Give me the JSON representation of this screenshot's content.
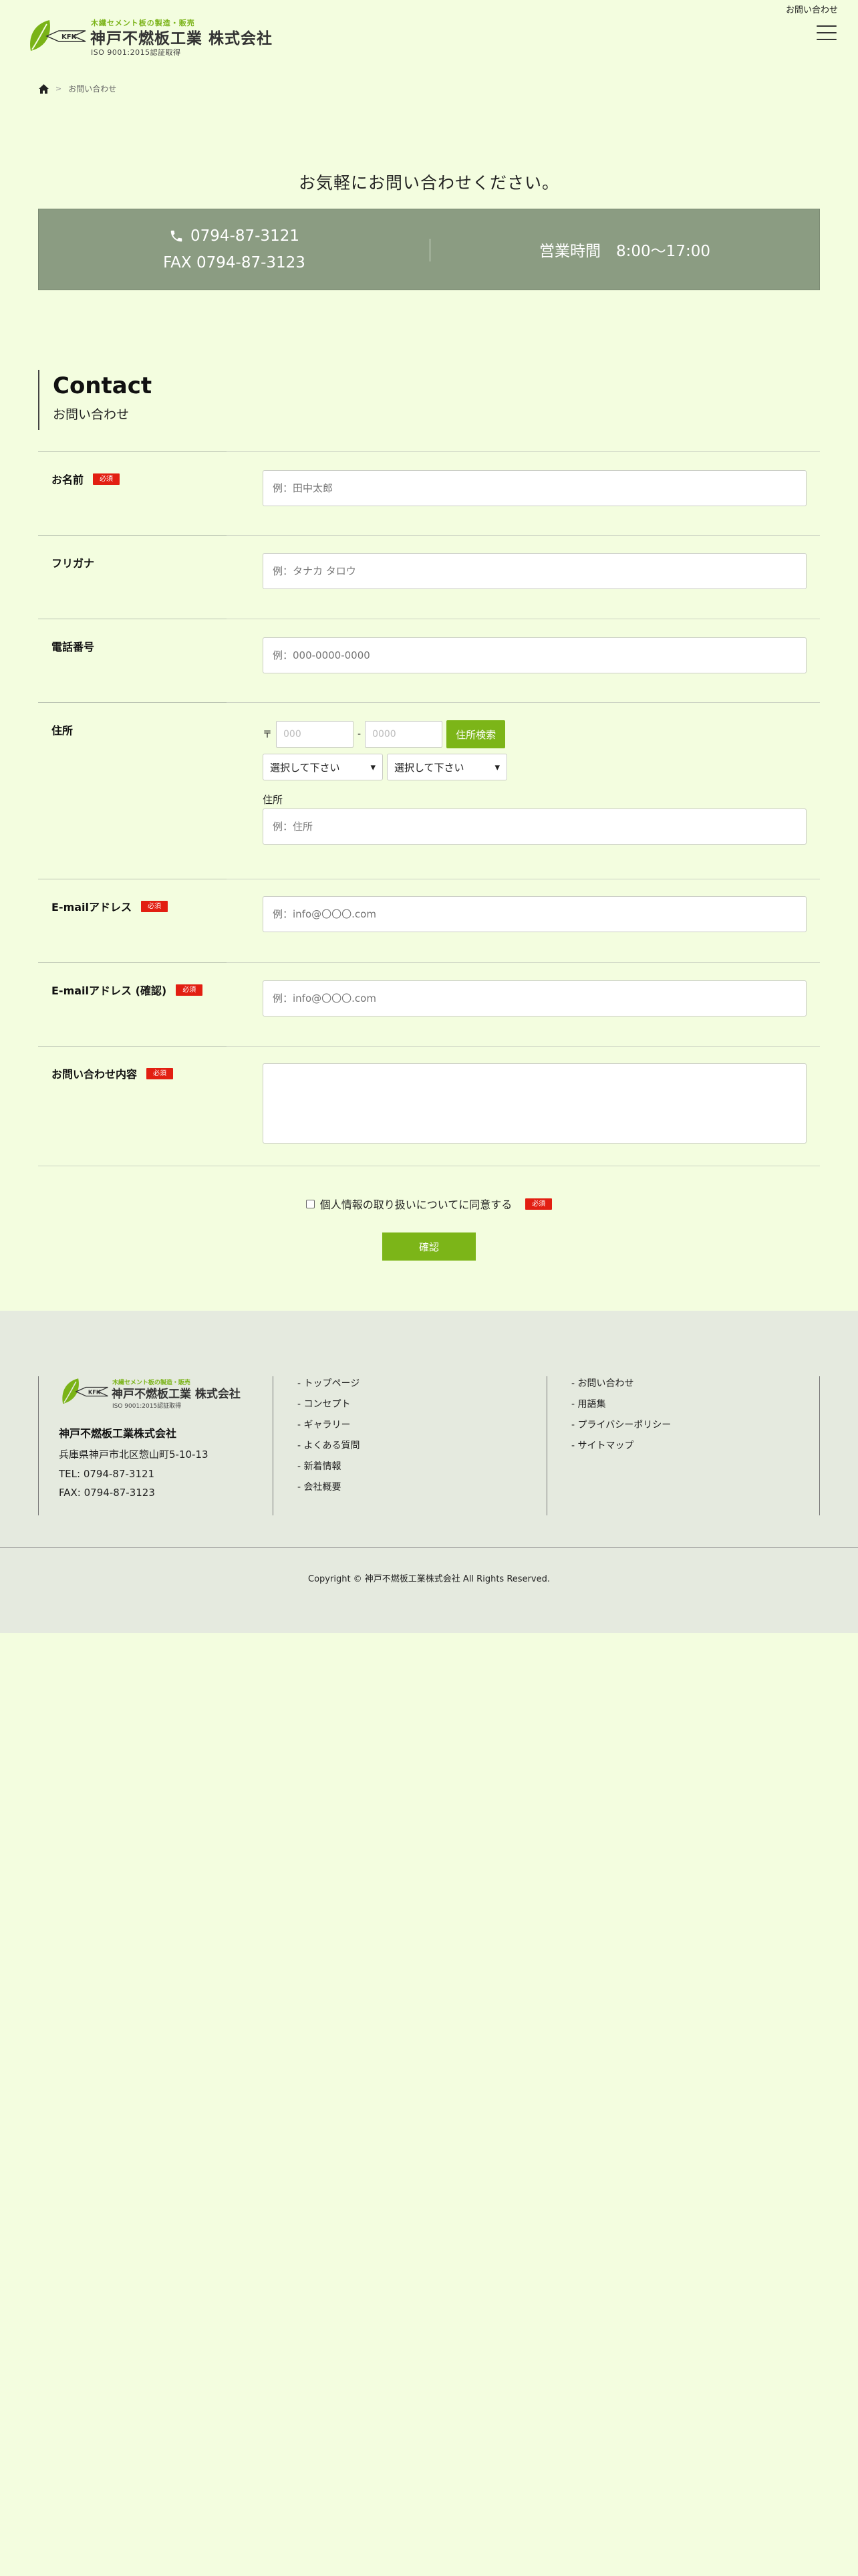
{
  "header": {
    "top_link": "お問い合わせ",
    "logo_tagline": "木繊セメント板の製造・販売",
    "logo_company": "神戸不燃板工業 株式会社",
    "logo_iso": "ISO 9001:2015認証取得",
    "logo_mark_text": "KFK"
  },
  "breadcrumb": {
    "current": "お問い合わせ"
  },
  "intro": {
    "title": "お気軽にお問い合わせください。",
    "phone": "0794-87-3121",
    "fax": "FAX 0794-87-3123",
    "hours": "営業時間　8:00〜17:00"
  },
  "section": {
    "title_en": "Contact",
    "title_ja": "お問い合わせ"
  },
  "form": {
    "required_label": "必須",
    "name_label": "お名前",
    "name_placeholder": "例：田中太郎",
    "kana_label": "フリガナ",
    "kana_placeholder": "例：タナカ タロウ",
    "tel_label": "電話番号",
    "tel_placeholder": "例：000-0000-0000",
    "address_label": "住所",
    "zip_mark": "〒",
    "zip1_placeholder": "000",
    "zip_dash": "-",
    "zip2_placeholder": "0000",
    "zip_search_button": "住所検索",
    "select_pref": "選択して下さい",
    "select_city": "選択して下さい",
    "address_sub_label": "住所",
    "address_placeholder": "例：住所",
    "email_label": "E-mailアドレス",
    "email_placeholder": "例：info@〇〇〇.com",
    "email_confirm_label": "E-mailアドレス (確認)",
    "email_confirm_placeholder": "例：info@〇〇〇.com",
    "message_label": "お問い合わせ内容",
    "agree_label": "個人情報の取り扱いについてに同意する",
    "confirm_button": "確認"
  },
  "footer": {
    "logo_tagline": "木繊セメント板の製造・販売",
    "logo_company": "神戸不燃板工業 株式会社",
    "logo_iso": "ISO 9001:2015認証取得",
    "company_name": "神戸不燃板工業株式会社",
    "address": "兵庫県神戸市北区惣山町5-10-13",
    "tel": "TEL: 0794-87-3121",
    "fax": "FAX: 0794-87-3123",
    "links_col1": [
      "- トップページ",
      "- コンセプト",
      "- ギャラリー",
      "- よくある質問",
      "- 新着情報",
      "- 会社概要"
    ],
    "links_col2": [
      "- お問い合わせ",
      "- 用語集",
      "- プライバシーポリシー",
      "- サイトマップ"
    ],
    "copyright": "Copyright © 神戸不燃板工業株式会社 All Rights Reserved."
  },
  "colors": {
    "background": "#f3fddf",
    "accent_green": "#7cb518",
    "band_gray_green": "#8b9c82",
    "required_red": "#e21f12",
    "footer_bg": "#e5eadf"
  },
  "icons": [
    "leaf-logo-icon",
    "hamburger-menu-icon",
    "home-icon",
    "phone-icon"
  ]
}
